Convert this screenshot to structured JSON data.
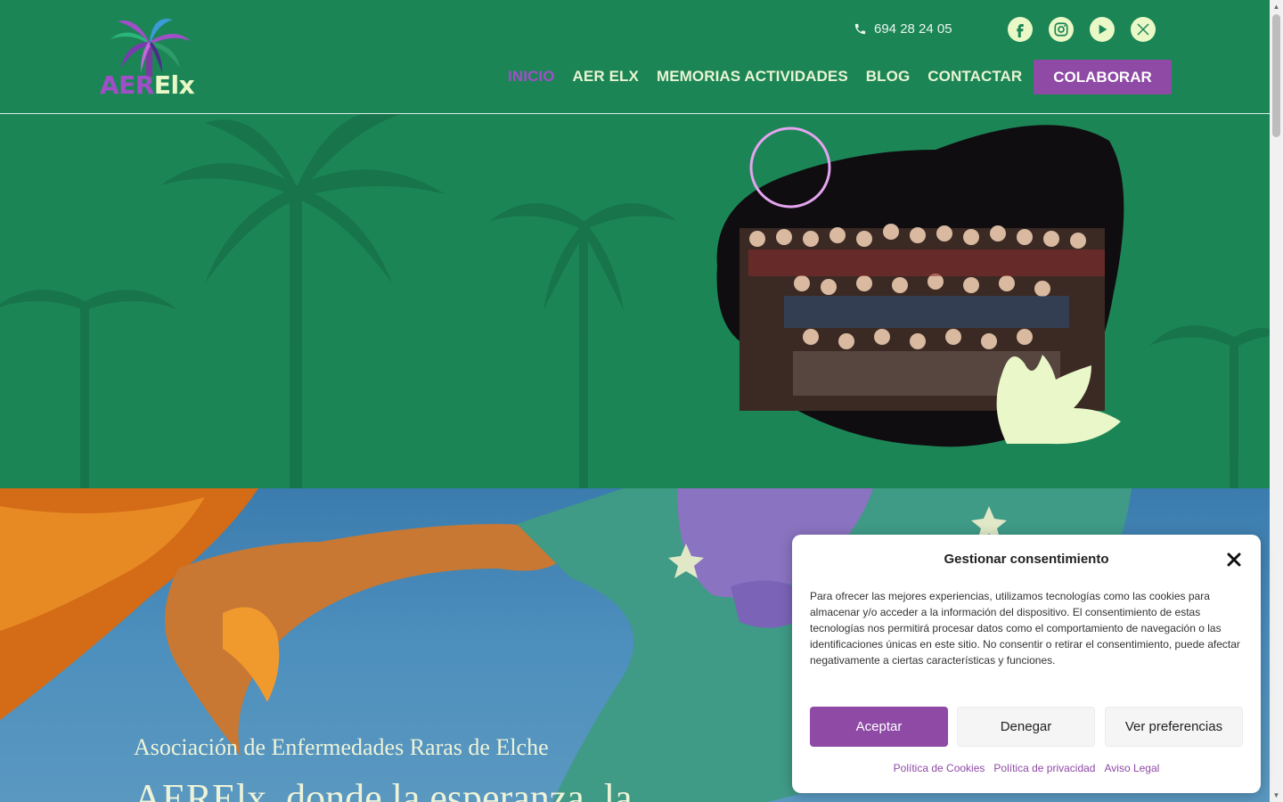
{
  "header": {
    "logo": {
      "part1": "AER",
      "part2": "Elx"
    },
    "phone": "694 28 24 05",
    "socials": [
      "facebook-icon",
      "instagram-icon",
      "youtube-icon",
      "x-twitter-icon"
    ],
    "nav": [
      {
        "label": "INICIO",
        "active": true
      },
      {
        "label": "AER ELX"
      },
      {
        "label": "MEMORIAS ACTIVIDADES"
      },
      {
        "label": "BLOG"
      },
      {
        "label": "CONTACTAR"
      }
    ],
    "cta": "COLABORAR"
  },
  "banner": {
    "subtitle": "Asociación de Enfermedades Raras de Elche",
    "title": "AERElx, donde la esperanza, la"
  },
  "consent": {
    "title": "Gestionar consentimiento",
    "text": "Para ofrecer las mejores experiencias, utilizamos tecnologías como las cookies para almacenar y/o acceder a la información del dispositivo. El consentimiento de estas tecnologías nos permitirá procesar datos como el comportamiento de navegación o las identificaciones únicas en este sitio. No consentir o retirar el consentimiento, puede afectar negativamente a ciertas características y funciones.",
    "accept": "Aceptar",
    "deny": "Denegar",
    "preferences": "Ver preferencias",
    "links": [
      "Política de Cookies",
      "Política de privacidad",
      "Aviso Legal"
    ]
  },
  "colors": {
    "green": "#1c8556",
    "purple": "#8e4aa5",
    "logo_purple": "#a24ec9",
    "cream": "#e9f8c6",
    "sky": "#4d8fbd"
  }
}
